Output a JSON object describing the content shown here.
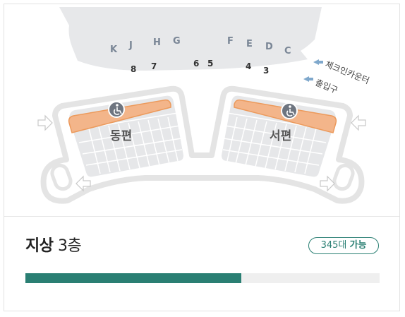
{
  "map": {
    "gates": [
      "K",
      "J",
      "H",
      "G",
      "F",
      "E",
      "D",
      "C"
    ],
    "doors": [
      "8",
      "7",
      "6",
      "5",
      "4",
      "3"
    ],
    "checkin_label": "체크인카운터",
    "entrance_label": "출입구",
    "east_label": "동편",
    "west_label": "서편",
    "wheelchair_icon": "wheelchair-icon",
    "arrow_icon": "arrow-icon"
  },
  "floor": {
    "name": "지상",
    "level": "3층"
  },
  "availability": {
    "count": "345대",
    "label": "가능",
    "fill_ratio": 0.61,
    "color_fill": "#2a7f73",
    "color_track": "#efefef"
  },
  "colors": {
    "accent": "#2a7f73",
    "priority_seats": "#f3b58a",
    "map_gray": "#e6e7e9"
  }
}
